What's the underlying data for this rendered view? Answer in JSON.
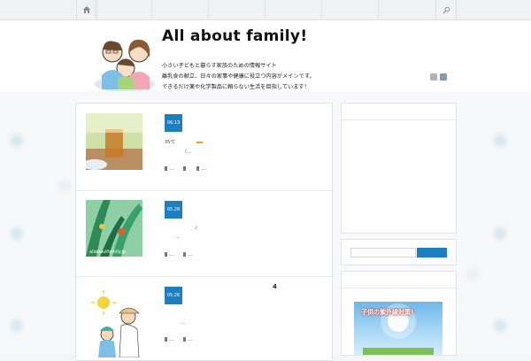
{
  "site": {
    "title": "All about family!",
    "tagline": [
      "小さい子どもと暮らす家族のための情報サイト",
      "離乳食の献立、日々の家事や健康に役立つ内容がメインです。",
      "できるだけ薬や化学製品に頼らない生活を目指しています！"
    ]
  },
  "nav": {
    "home_icon": "home-icon",
    "search_icon": "search-icon"
  },
  "posts": [
    {
      "date": "06.13",
      "text_lines": [
        "35℃",
        "（…"
      ],
      "meta": [
        "___",
        "___"
      ]
    },
    {
      "date": "05.28",
      "text_lines": [
        "♪",
        "…"
      ],
      "meta": [
        "___",
        "___"
      ],
      "thumb_watermark": "allaboutfamily.jp"
    },
    {
      "date": "05.26",
      "text_lines": [
        "…"
      ],
      "meta": [
        "___",
        "___"
      ],
      "number": "4"
    }
  ],
  "sidebar": {
    "banner_text": "子供の紫外線対策！"
  },
  "colors": {
    "accent": "#1e7fc0"
  }
}
